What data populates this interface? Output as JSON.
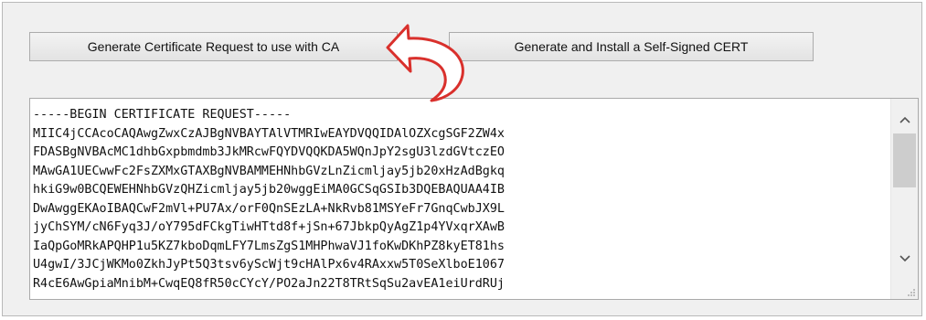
{
  "buttons": {
    "generate_csr_label": "Generate Certificate Request to use with CA",
    "self_signed_label": "Generate and Install a Self-Signed CERT"
  },
  "csr_textarea": {
    "lines": [
      "-----BEGIN CERTIFICATE REQUEST-----",
      "MIIC4jCCAcoCAQAwgZwxCzAJBgNVBAYTAlVTMRIwEAYDVQQIDAlOZXcgSGF2ZW4x",
      "FDASBgNVBAcMC1dhbGxpbmdmb3JkMRcwFQYDVQQKDA5WQnJpY2sgU3lzdGVtczEO",
      "MAwGA1UECwwFc2FsZXMxGTAXBgNVBAMMEHNhbGVzLnZicmljay5jb20xHzAdBgkq",
      "hkiG9w0BCQEWEHNhbGVzQHZicmljay5jb20wggEiMA0GCSqGSIb3DQEBAQUAA4IB",
      "DwAwggEKAoIBAQCwF2mVl+PU7Ax/orF0QnSEzLA+NkRvb81MSYeFr7GnqCwbJX9L",
      "jyChSYM/cN6Fyq3J/oY795dFCkgTiwHTtd8f+jSn+67JbkpQyAgZ1p4YVxqrXAwB",
      "IaQpGoMRkAPQHP1u5KZ7kboDqmLFY7LmsZgS1MHPhwaVJ1foKwDKhPZ8kyET81hs",
      "U4gwI/3JCjWKMo0ZkhJyPt5Q3tsv6yScWjt9cHAlPx6v4RAxxw5T0SeXlboE1067",
      "R4cE6AwGpiaMnibM+CwqEQ8fR50cCYcY/PO2aJn22T8TRtSqSu2avEA1eiUrdRUj"
    ]
  },
  "icons": {
    "arrow": "curved-arrow-icon",
    "scroll_up": "chevron-up-icon",
    "scroll_down": "chevron-down-icon",
    "resize": "resize-grip-icon"
  },
  "colors": {
    "arrow_fill": "#ffffff",
    "arrow_stroke": "#d9302c"
  }
}
